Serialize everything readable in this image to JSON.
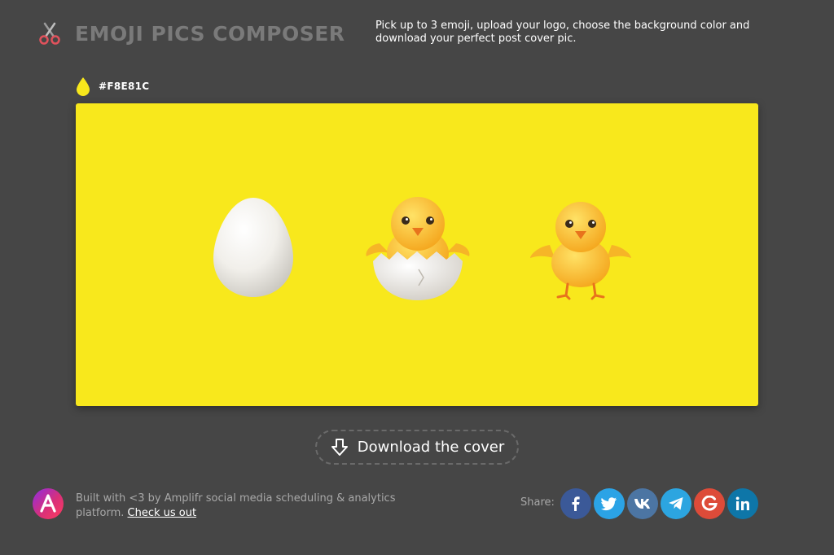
{
  "header": {
    "logo_icon": "scissors-icon",
    "title": "EMOJI PICS COMPOSER",
    "tagline": "Pick up to 3 emoji, upload your logo, choose the background color and download your perfect post cover pic."
  },
  "color_picker": {
    "icon": "color-drop-icon",
    "hex_label": "#F8E81C",
    "color": "#F8E81C"
  },
  "canvas": {
    "background": "#F8E81C",
    "emoji": [
      "egg",
      "hatching-chick",
      "baby-chick"
    ]
  },
  "download": {
    "icon": "download-arrow-icon",
    "label": "Download the cover"
  },
  "footer": {
    "logo_icon": "amplifr-logo-icon",
    "built_text": "Built with <3 by Amplifr social media scheduling & analytics platform.",
    "link_text": "Check us out",
    "share_label": "Share:",
    "share": [
      {
        "name": "facebook",
        "color": "#3b5998"
      },
      {
        "name": "twitter",
        "color": "#2ba3e6"
      },
      {
        "name": "vk",
        "color": "#4c75a3"
      },
      {
        "name": "telegram",
        "color": "#2ca5e0"
      },
      {
        "name": "google",
        "color": "#dd4b39"
      },
      {
        "name": "linkedin",
        "color": "#0e76a8"
      }
    ]
  }
}
